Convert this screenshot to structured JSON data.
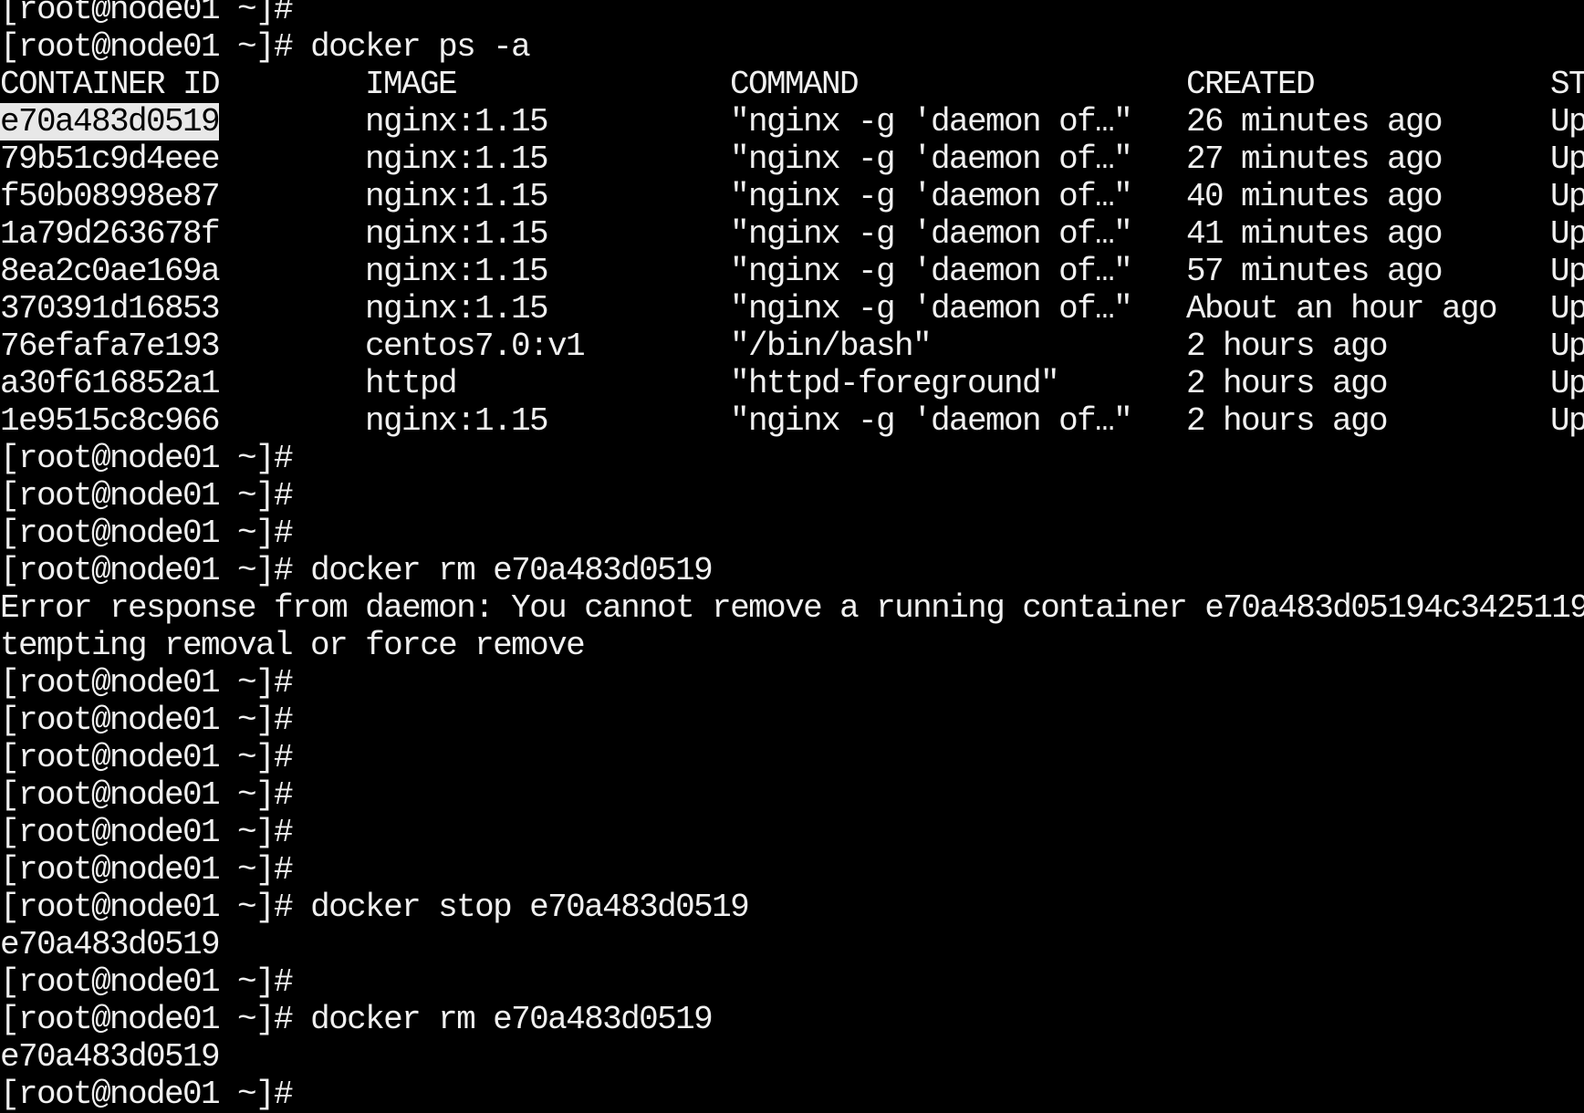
{
  "terminal": {
    "prompt": "[root@node01 ~]#",
    "background": "#000000",
    "foreground": "#f0f0f0",
    "selection_background": "#e8e8e8",
    "table": {
      "headers": [
        "CONTAINER ID",
        "IMAGE",
        "COMMAND",
        "CREATED",
        "ST"
      ],
      "rows": [
        [
          "e70a483d0519",
          "nginx:1.15",
          "\"nginx -g 'daemon of…\"",
          "26 minutes ago",
          "Up"
        ],
        [
          "79b51c9d4eee",
          "nginx:1.15",
          "\"nginx -g 'daemon of…\"",
          "27 minutes ago",
          "Up"
        ],
        [
          "f50b08998e87",
          "nginx:1.15",
          "\"nginx -g 'daemon of…\"",
          "40 minutes ago",
          "Up"
        ],
        [
          "1a79d263678f",
          "nginx:1.15",
          "\"nginx -g 'daemon of…\"",
          "41 minutes ago",
          "Up"
        ],
        [
          "8ea2c0ae169a",
          "nginx:1.15",
          "\"nginx -g 'daemon of…\"",
          "57 minutes ago",
          "Up"
        ],
        [
          "370391d16853",
          "nginx:1.15",
          "\"nginx -g 'daemon of…\"",
          "About an hour ago",
          "Up"
        ],
        [
          "76efafa7e193",
          "centos7.0:v1",
          "\"/bin/bash\"",
          "2 hours ago",
          "Up"
        ],
        [
          "a30f616852a1",
          "httpd",
          "\"httpd-foreground\"",
          "2 hours ago",
          "Up"
        ],
        [
          "1e9515c8c966",
          "nginx:1.15",
          "\"nginx -g 'daemon of…\"",
          "2 hours ago",
          "Up"
        ]
      ]
    },
    "lines_before": [
      {
        "type": "prompt",
        "cmd": ""
      },
      {
        "type": "prompt",
        "cmd": "docker ps -a"
      }
    ],
    "lines_after": [
      {
        "type": "prompt",
        "cmd": ""
      },
      {
        "type": "prompt",
        "cmd": ""
      },
      {
        "type": "prompt",
        "cmd": ""
      },
      {
        "type": "prompt",
        "cmd": "docker rm e70a483d0519"
      },
      {
        "type": "output",
        "text": "Error response from daemon: You cannot remove a running container e70a483d05194c3425119"
      },
      {
        "type": "output",
        "text": "tempting removal or force remove"
      },
      {
        "type": "prompt",
        "cmd": ""
      },
      {
        "type": "prompt",
        "cmd": ""
      },
      {
        "type": "prompt",
        "cmd": ""
      },
      {
        "type": "prompt",
        "cmd": ""
      },
      {
        "type": "prompt",
        "cmd": ""
      },
      {
        "type": "prompt",
        "cmd": ""
      },
      {
        "type": "prompt",
        "cmd": "docker stop e70a483d0519"
      },
      {
        "type": "output",
        "text": "e70a483d0519"
      },
      {
        "type": "prompt",
        "cmd": ""
      },
      {
        "type": "prompt",
        "cmd": "docker rm e70a483d0519"
      },
      {
        "type": "output",
        "text": "e70a483d0519"
      },
      {
        "type": "prompt",
        "cmd": ""
      }
    ]
  }
}
